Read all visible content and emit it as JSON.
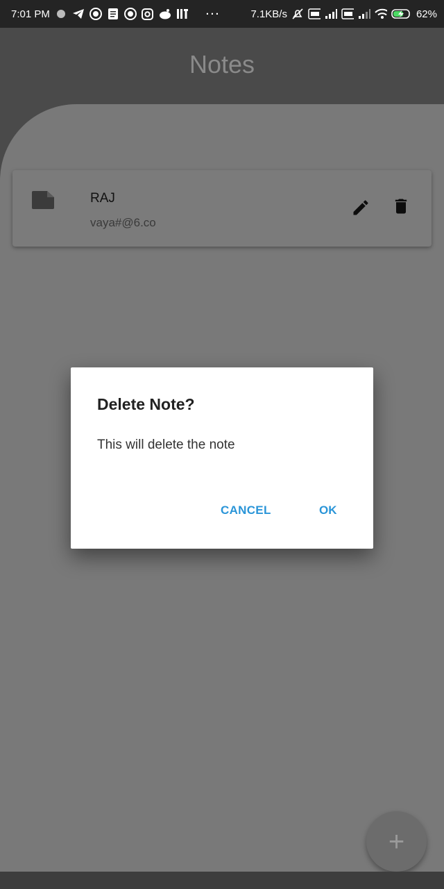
{
  "status_bar": {
    "time": "7:01 PM",
    "net_speed": "7.1KB/s",
    "battery": "62%"
  },
  "app": {
    "title": "Notes"
  },
  "notes": [
    {
      "title": "RAJ",
      "subtitle": "vaya#@6.co"
    }
  ],
  "dialog": {
    "title": "Delete Note?",
    "message": "This will delete the note",
    "cancel_label": "CANCEL",
    "ok_label": "OK",
    "accent_color": "#2a95d8"
  },
  "fab": {
    "icon": "plus-icon",
    "label": "+"
  },
  "colors": {
    "appbar": "#4a4a4a",
    "scrim_bg": "#797979",
    "dialog_bg": "#ffffff"
  }
}
